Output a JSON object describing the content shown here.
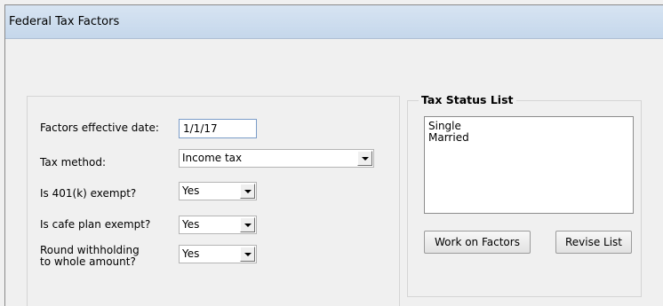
{
  "window": {
    "title": "Federal Tax Factors"
  },
  "form": {
    "effective_date_label": "Factors effective date:",
    "effective_date_value": "1/1/17",
    "tax_method_label": "Tax method:",
    "tax_method_value": "Income tax",
    "k401_label": "Is 401(k) exempt?",
    "k401_value": "Yes",
    "cafe_label": "Is cafe plan exempt?",
    "cafe_value": "Yes",
    "round_label": "Round withholding\nto whole amount?",
    "round_value": "Yes"
  },
  "tax_status": {
    "legend": "Tax Status List",
    "items": [
      "Single",
      "Married"
    ],
    "work_button": "Work on Factors",
    "revise_button": "Revise List"
  },
  "icons": {
    "dropdown": "chevron-down-icon"
  }
}
